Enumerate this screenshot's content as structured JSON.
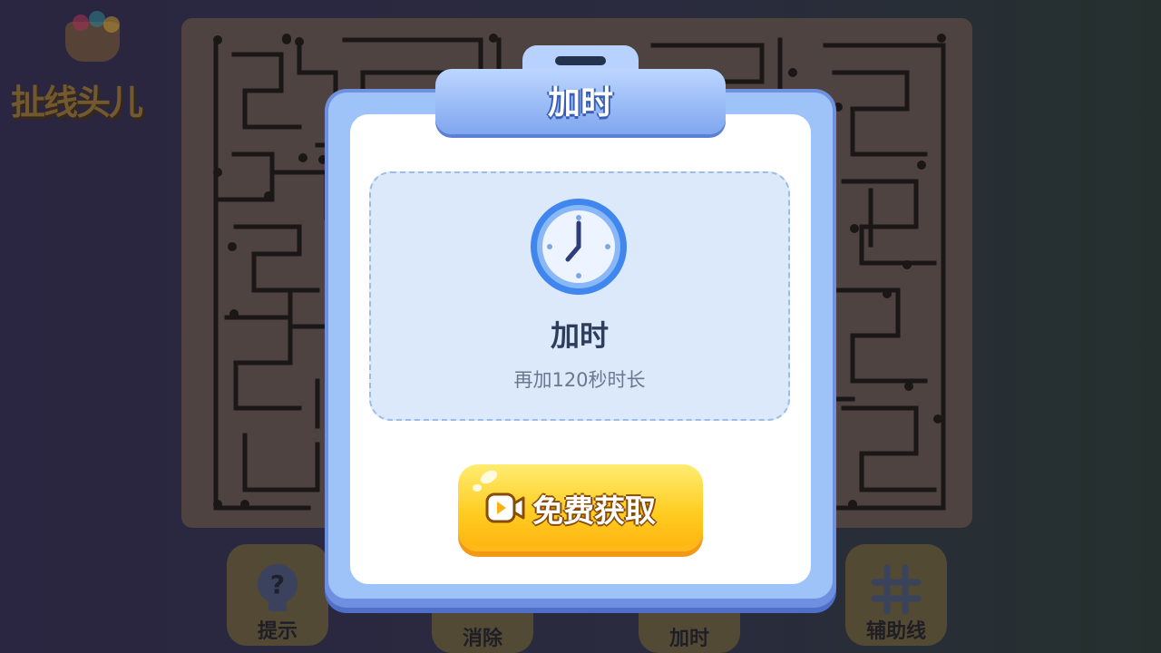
{
  "logo": {
    "text": "扯线头儿"
  },
  "toolbar": [
    {
      "label": "提示",
      "icon": "question-bulb-icon"
    },
    {
      "label": "消除",
      "icon": "eraser-icon"
    },
    {
      "label": "加时",
      "icon": "clock-icon"
    },
    {
      "label": "辅助线",
      "icon": "grid-icon"
    }
  ],
  "dialog": {
    "title": "加时",
    "reward_icon": "clock-icon",
    "reward_title": "加时",
    "reward_desc": "再加120秒时长",
    "button_label": "免费获取",
    "button_icon": "video-icon"
  },
  "colors": {
    "dialog_frame": "#6f8fe0",
    "panel_bg": "#dce9fb",
    "button_yellow": "#ffcd22",
    "maze_board": "#4e4340"
  }
}
